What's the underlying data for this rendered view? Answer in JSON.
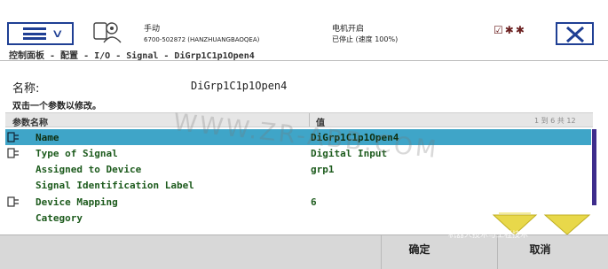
{
  "header": {
    "mode": "手动",
    "system": "6700-502872 (HANZHUANGBAOQEA)",
    "motor_status": "电机开启",
    "run_status": "已停止 (速度 100%)",
    "status_icons": "☑✱✱"
  },
  "breadcrumb": "控制面板 - 配置 - I/O - Signal - DiGrp1C1p1Open4",
  "name_label": "名称:",
  "name_value": "DiGrp1C1p1Open4",
  "hint": "双击一个参数以修改。",
  "table": {
    "col_param": "参数名称",
    "col_value": "值",
    "row_count": "1 到 6 共 12",
    "rows": [
      {
        "name": "Name",
        "value": "DiGrp1C1p1Open4",
        "selected": true,
        "icon": "param-icon"
      },
      {
        "name": "Type of Signal",
        "value": "Digital Input",
        "selected": false,
        "icon": "param-icon"
      },
      {
        "name": "Assigned to Device",
        "value": "grp1",
        "selected": false,
        "icon": ""
      },
      {
        "name": "Signal Identification Label",
        "value": "",
        "selected": false,
        "icon": ""
      },
      {
        "name": "Device Mapping",
        "value": "6",
        "selected": false,
        "icon": "param-icon"
      },
      {
        "name": "Category",
        "value": "",
        "selected": false,
        "icon": ""
      }
    ]
  },
  "buttons": {
    "ok": "确定",
    "cancel": "取消"
  },
  "watermark": "WWW.ZR-ABB.COM",
  "watermark_small": "机器人技术与工程技术",
  "colors": {
    "accent": "#1f3f94",
    "selected_row": "#3fa5c8",
    "scrollbar": "#3e2d8c",
    "arrows": "#e8d84a"
  }
}
